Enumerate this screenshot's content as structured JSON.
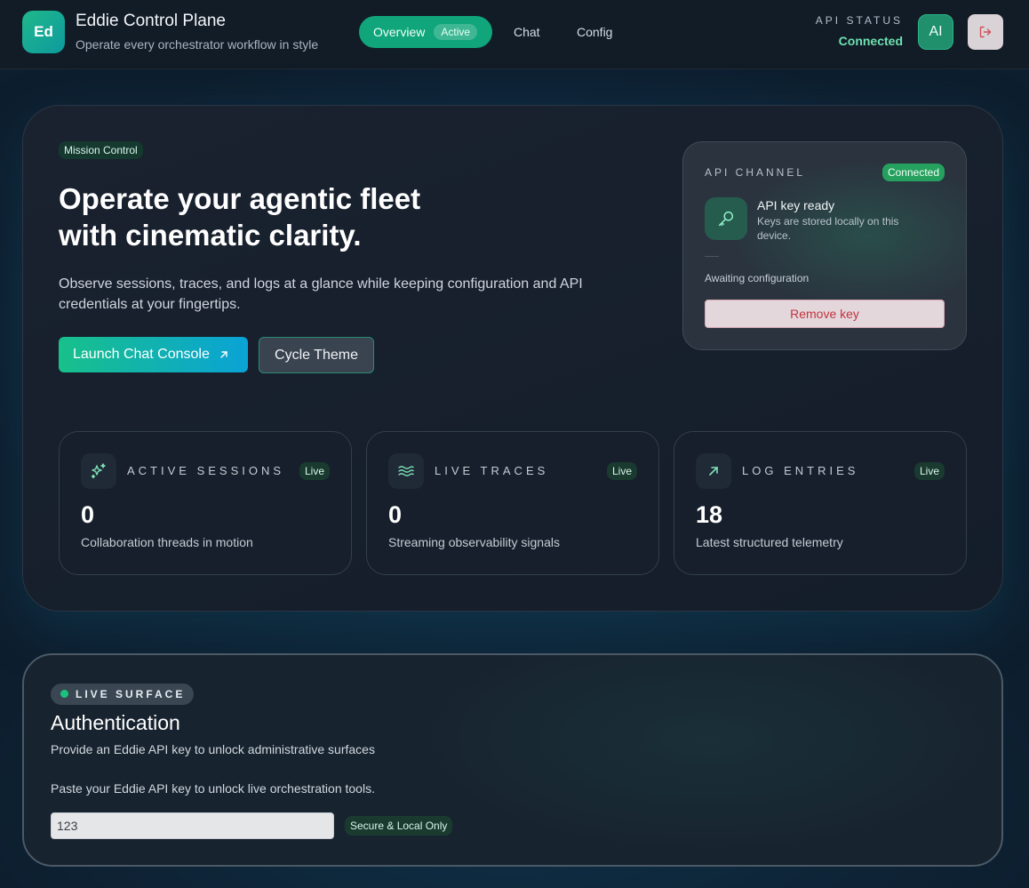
{
  "header": {
    "logo_text": "Ed",
    "title": "Eddie Control Plane",
    "subtitle": "Operate every orchestrator workflow in style",
    "nav": {
      "overview_label": "Overview",
      "overview_badge": "Active",
      "chat_label": "Chat",
      "config_label": "Config"
    },
    "api_status_label": "API STATUS",
    "api_status_value": "Connected",
    "ai_button_label": "AI"
  },
  "hero": {
    "tag": "Mission Control",
    "title": "Operate your agentic fleet with cinematic clarity.",
    "description": "Observe sessions, traces, and logs at a glance while keeping configuration and API credentials at your fingertips.",
    "launch_button": "Launch Chat Console",
    "cycle_button": "Cycle Theme"
  },
  "api_channel": {
    "label": "API CHANNEL",
    "badge": "Connected",
    "key_title": "API key ready",
    "key_desc": "Keys are stored locally on this device.",
    "awaiting": "Awaiting configuration",
    "remove_button": "Remove key"
  },
  "stats": [
    {
      "label": "ACTIVE SESSIONS",
      "live": "Live",
      "value": "0",
      "desc": "Collaboration threads in motion",
      "icon": "sparkles-icon"
    },
    {
      "label": "LIVE TRACES",
      "live": "Live",
      "value": "0",
      "desc": "Streaming observability signals",
      "icon": "waves-icon"
    },
    {
      "label": "LOG ENTRIES",
      "live": "Live",
      "value": "18",
      "desc": "Latest structured telemetry",
      "icon": "arrow-up-right-icon"
    }
  ],
  "auth": {
    "pill": "LIVE SURFACE",
    "title": "Authentication",
    "subtitle": "Provide an Eddie API key to unlock administrative surfaces",
    "paste_text": "Paste your Eddie API key to unlock live orchestration tools.",
    "input_value": "123",
    "badge": "Secure & Local Only"
  },
  "colors": {
    "accent": "#10a57a",
    "status_connected": "#6ee2b0",
    "danger": "#c2343e"
  }
}
